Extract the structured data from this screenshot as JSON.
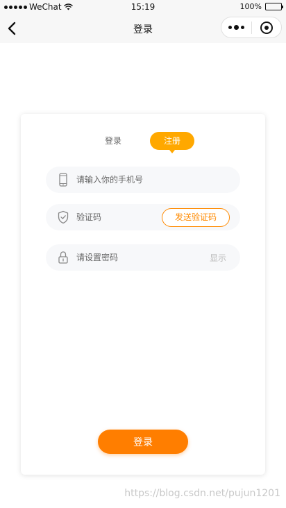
{
  "status_bar": {
    "carrier": "WeChat",
    "time": "15:19",
    "battery": "100%",
    "battery_level": 1.0
  },
  "nav": {
    "title": "登录"
  },
  "tabs": {
    "login": "登录",
    "register": "注册",
    "active": "register"
  },
  "form": {
    "phone_placeholder": "请输入你的手机号",
    "code_placeholder": "验证码",
    "send_code_label": "发送验证码",
    "password_placeholder": "请设置密码",
    "show_label": "显示",
    "submit_label": "登录"
  },
  "watermark": "https://blog.csdn.net/pujun1201",
  "colors": {
    "accent": "#ffa800",
    "button": "#ff7e00",
    "outline": "#ff8a00"
  },
  "icons": {
    "phone": "phone-icon",
    "shield": "shield-icon",
    "lock": "lock-icon"
  }
}
